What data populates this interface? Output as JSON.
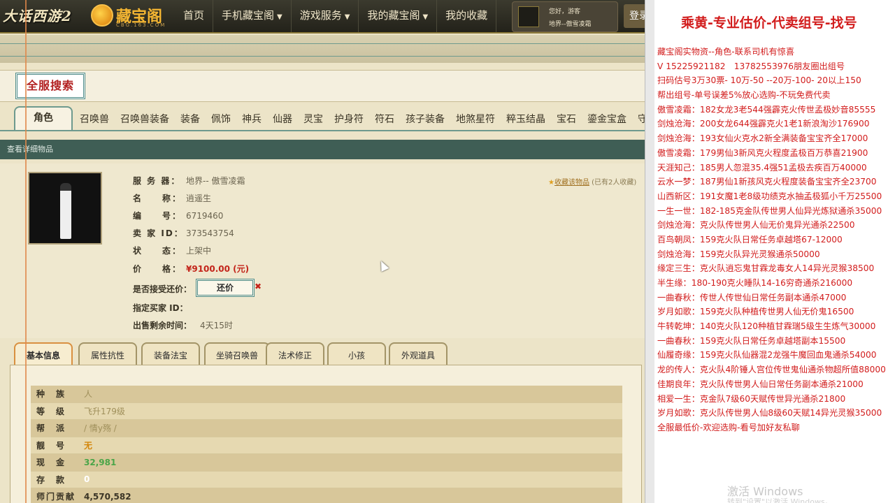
{
  "topbar": {
    "game_logo": "大话西游2",
    "cbg_logo": "藏宝阁",
    "cbg_logo_sub": "CBG.163.COM",
    "nav": [
      {
        "label": "首页",
        "caret": false
      },
      {
        "label": "手机藏宝阁",
        "caret": true
      },
      {
        "label": "游戏服务",
        "caret": true
      },
      {
        "label": "我的藏宝阁",
        "caret": true
      },
      {
        "label": "我的收藏",
        "caret": false
      }
    ],
    "greeting": "您好，游客",
    "server": "地界--傲雪凌霜",
    "login": "登录"
  },
  "search_badge": "全服搜索",
  "categories": [
    "角色",
    "召唤兽",
    "召唤兽装备",
    "装备",
    "佩饰",
    "神兵",
    "仙器",
    "灵宝",
    "护身符",
    "符石",
    "孩子装备",
    "地煞星符",
    "粹玉结晶",
    "宝石",
    "鎏金宝盒",
    "守护"
  ],
  "detail_bar": "查看详细物品",
  "item": {
    "server_label": "服 务 器：",
    "server": "地界-- 傲雪凌霜",
    "name_label": "名　　称：",
    "name": "逍遥生",
    "id_label": "编　　号：",
    "id": "6719460",
    "seller_label": "卖 家 ID：",
    "seller": "373543754",
    "status_label": "状　　态：",
    "status": "上架中",
    "price_label": "价　　格：",
    "price": "¥9100.00 (元)",
    "counter_label": "是否接受还价：",
    "counter_btn": "还价",
    "buyer_label": "指定买家 ID：",
    "time_label": "出售剩余时间：",
    "time": "4天15时"
  },
  "collect": {
    "link": "收藏该物品",
    "note": "(已有2人收藏)"
  },
  "tabs": [
    "基本信息",
    "属性抗性",
    "装备法宝",
    "坐骑召唤兽",
    "法术修正",
    "小孩",
    "外观道具"
  ],
  "attributes": [
    {
      "k": "种　族",
      "v": "人",
      "style": "av"
    },
    {
      "k": "等　级",
      "v": "飞升179级",
      "style": "av"
    },
    {
      "k": "帮　派",
      "v": "/ 情y殇 /",
      "style": "av"
    },
    {
      "k": "靓　号",
      "v": "无",
      "style": "av o"
    },
    {
      "k": "现　金",
      "v": "32,981",
      "style": "av g"
    },
    {
      "k": "存　款",
      "v": "0",
      "style": "av w"
    },
    {
      "k": "师门贡献",
      "v": "4,570,582",
      "style": "av d"
    }
  ],
  "right": {
    "title": "乘黄-专业估价-代卖组号-找号",
    "lines": [
      "藏宝阁实物资--角色-联系司机有惊喜",
      "V 15225921182　13782553976朋友圈出组号",
      "扫码估号3万30票- 10万-50 --20万-100- 20以上150",
      "帮出组号-单号误差5%放心选购-不玩免费代卖",
      "傲雪凌霜：182女龙3老544强霹克火传世孟极妙音85555",
      "剑烛沧海：200女龙644强霹克火1老1新浪淘沙176900",
      "剑烛沧海：193女仙火克水2新全满装备宝宝齐全17000",
      "傲雪凌霜：179男仙3新风克火程度孟极百万恭喜21900",
      "天涯知己：185男人忽混35.4强51孟极去疾百万40000",
      "云水一梦：187男仙1新孩风克火程度装备宝宝齐全23700",
      "山西新区：191女魔1老8级功绩克水抽孟极狐小千万25500",
      "一生一世：182-185克金队传世男人仙异光炼狱通杀35000",
      "剑烛沧海：克火队传世男人仙无价鬼异光通杀22500",
      "百鸟朝凤：159克火队日常任务卓越塔67-12000",
      "剑烛沧海：159克火队异光灵猴通杀50000",
      "缘定三生：克火队逍忘鬼甘霖龙毒女人14异光灵猴38500",
      "半生缘：180-190克火睡队14-16穷奇通杀216000",
      "一曲春秋：传世人传世仙日常任务副本通杀47000",
      "岁月如歌：159克火队种植传世男人仙无价鬼16500",
      "牛转乾坤：140克火队120种植甘霖瑞5级生生炼气30000",
      "一曲春秋：159克火队日常任务卓越塔副本15500",
      "仙履奇缘：159克火队仙器混2龙强牛魔回血鬼通杀54000",
      "龙的传人：克火队4阶锤人宫位传世鬼仙通杀物超所值88000",
      "佳期良年：克火队传世男人仙日常任务副本通杀21000",
      "相爱一生：克金队7级60天赋传世异光通杀21800",
      "岁月如歌：克火队传世男人仙8级60天赋14异光灵猴35000",
      "全服最低价-欢迎选购-看号加好友私聊"
    ],
    "watermark": "激活 Windows",
    "watermark_sub": "转到\"设置\"以激活 Windows。"
  }
}
